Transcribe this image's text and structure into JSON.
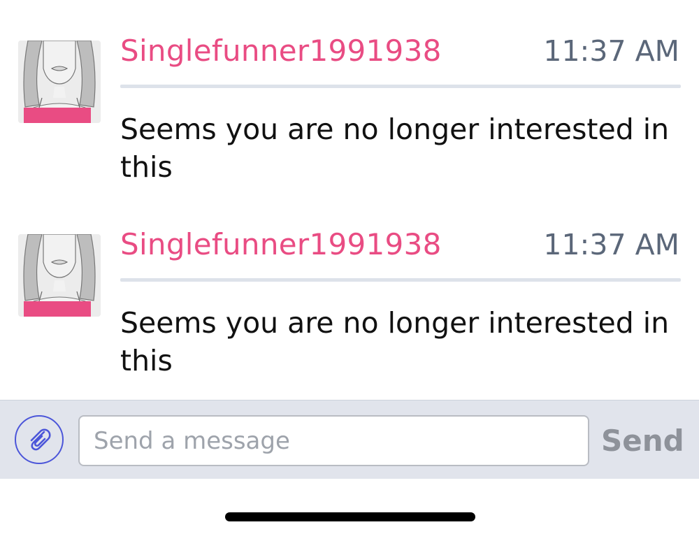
{
  "colors": {
    "sender_name": "#e94c83",
    "timestamp": "#5b6779",
    "accent": "#4b55d9",
    "composer_bg": "#e1e4ec",
    "avatar_top": "#e94c83"
  },
  "messages": [
    {
      "sender": "Singlefunner1991938",
      "time": "11:37 AM",
      "text": "Seems you are no longer interested in this",
      "avatar_icon": "female-profile-avatar"
    },
    {
      "sender": "Singlefunner1991938",
      "time": "11:37 AM",
      "text": "Seems you are no longer interested in this",
      "avatar_icon": "female-profile-avatar"
    }
  ],
  "composer": {
    "attach_icon": "paperclip-icon",
    "input_placeholder": "Send a message",
    "input_value": "",
    "send_label": "Send"
  }
}
